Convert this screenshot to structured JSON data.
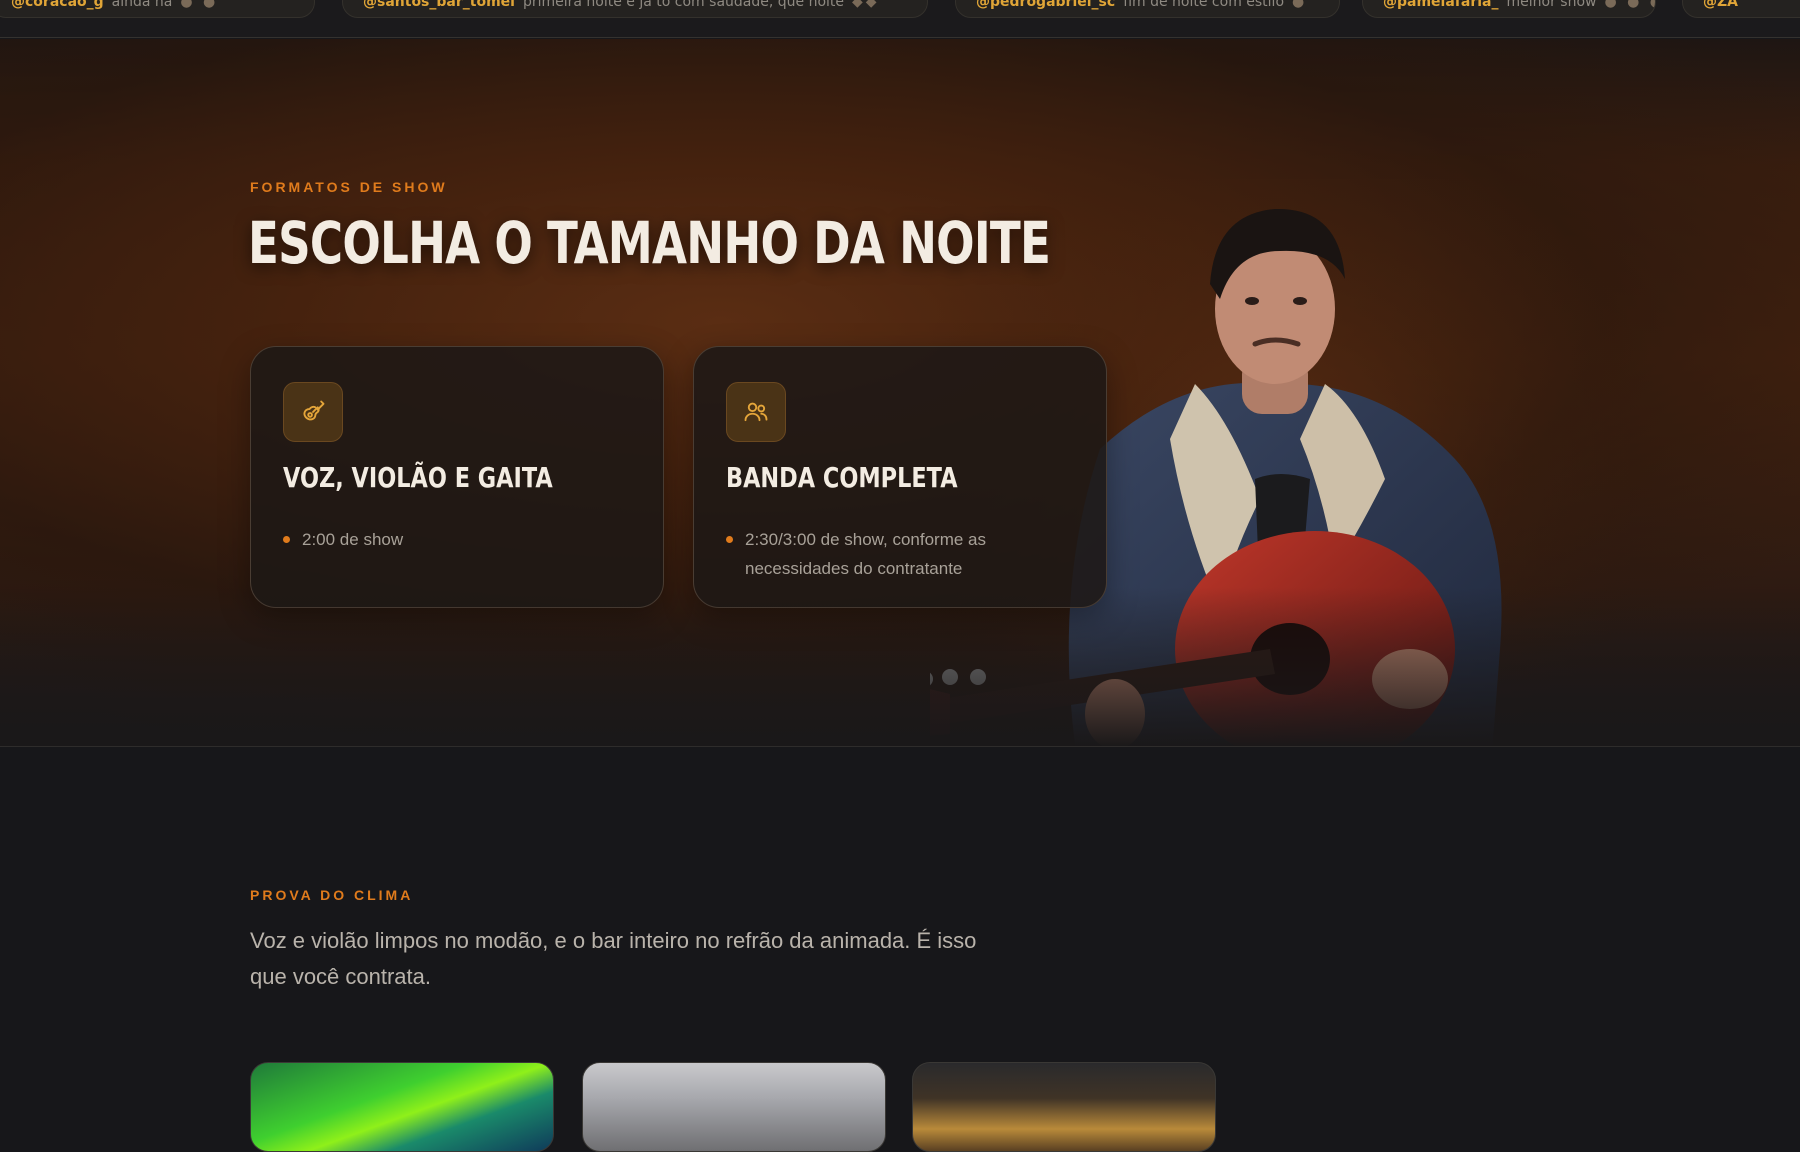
{
  "ticker": {
    "items": [
      {
        "handle": "@coracao_g",
        "text": "ainda na",
        "emoji": "● ●"
      },
      {
        "handle": "@santos_bar_tomei",
        "text": "primeira noite e ja to com saudade, que noite",
        "emoji": "◆◆"
      },
      {
        "handle": "@pedrogabriel_sc",
        "text": "fim de noite com estilo",
        "emoji": "●"
      },
      {
        "handle": "@pamelafaria_",
        "text": "melhor show",
        "emoji": "● ● ● ●"
      },
      {
        "handle": "@ZA",
        "text": "",
        "emoji": ""
      }
    ]
  },
  "formats": {
    "eyebrow": "FORMATOS DE SHOW",
    "title": "ESCOLHA O TAMANHO DA NOITE",
    "cards": [
      {
        "icon": "guitar-icon",
        "title": "VOZ, VIOLÃO E GAITA",
        "detail": "2:00 de show"
      },
      {
        "icon": "users-icon",
        "title": "BANDA COMPLETA",
        "detail": "2:30/3:00 de show, conforme as necessidades do contratante"
      }
    ]
  },
  "proof": {
    "eyebrow": "PROVA DO CLIMA",
    "text": "Voz e violão limpos no modão, e o bar inteiro no refrão da animada. É isso que você contrata."
  },
  "colors": {
    "accent": "#e07b1c",
    "icon_gold": "#e5a63a",
    "background": "#17171a"
  }
}
